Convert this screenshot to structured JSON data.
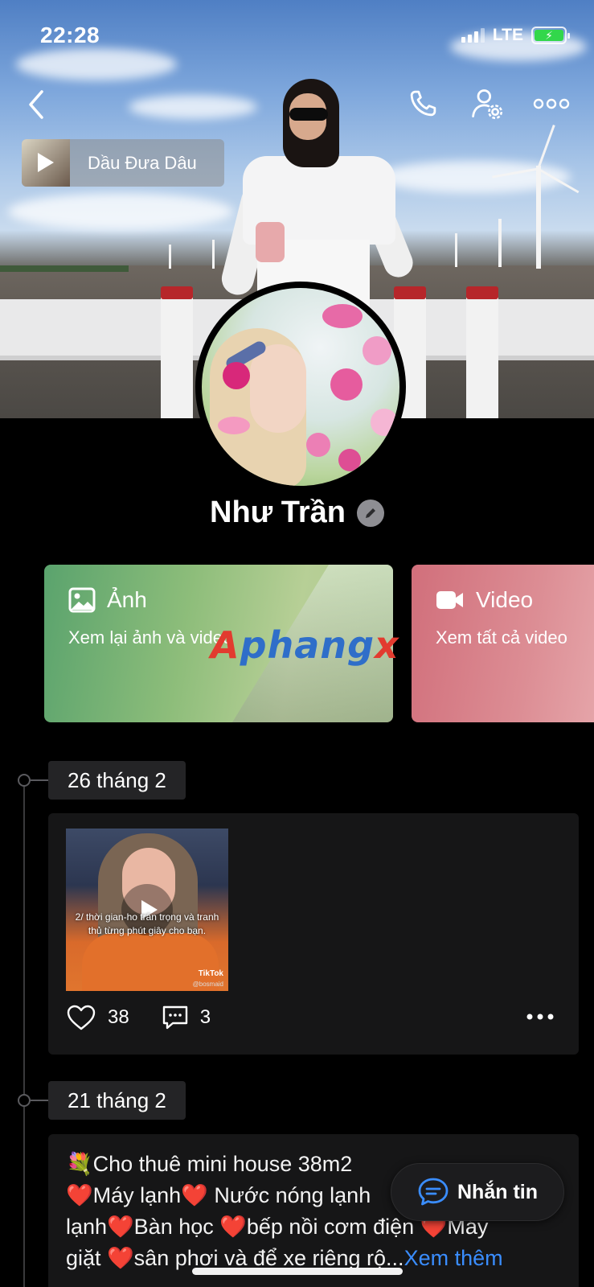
{
  "status_bar": {
    "time": "22:28",
    "network": "LTE",
    "battery_color": "#32d74b"
  },
  "nav": {
    "back_icon": "chevron-left-icon",
    "call_icon": "phone-icon",
    "settings_icon": "user-settings-icon",
    "more_icon": "more-horizontal-icon"
  },
  "music": {
    "title": "Dầu Đưa Dâu"
  },
  "profile": {
    "name": "Như Trần"
  },
  "cards": {
    "photo": {
      "title": "Ảnh",
      "subtitle": "Xem lại ảnh và video",
      "icon": "image-icon"
    },
    "video": {
      "title": "Video",
      "subtitle": "Xem tất cả video",
      "icon": "video-camera-icon"
    }
  },
  "watermark": {
    "part1": "A",
    "part2": "phang",
    "part3": "x"
  },
  "timeline": [
    {
      "date": "26 tháng 2",
      "video_caption": "2/ thời gian-ho trân trọng và tranh thủ từng phút giây cho bạn.",
      "video_source": "TikTok",
      "video_handle": "@bosmaid",
      "likes": "38",
      "comments": "3"
    },
    {
      "date": "21 tháng 2",
      "line1": "💐Cho thuê mini house 38m2",
      "line2a": "Máy lạnh",
      "line2b": " Nước nóng lạnh",
      "line3a": "lạnh",
      "line3b": "Bàn học ",
      "line3c": "bếp nồi cơm điện ",
      "line3d": "Máy",
      "line4a": "giặt ",
      "line4b": "sân phơi và để xe riêng rộ...",
      "see_more": "Xem thêm"
    }
  ],
  "chat_button": {
    "label": "Nhắn tin"
  }
}
